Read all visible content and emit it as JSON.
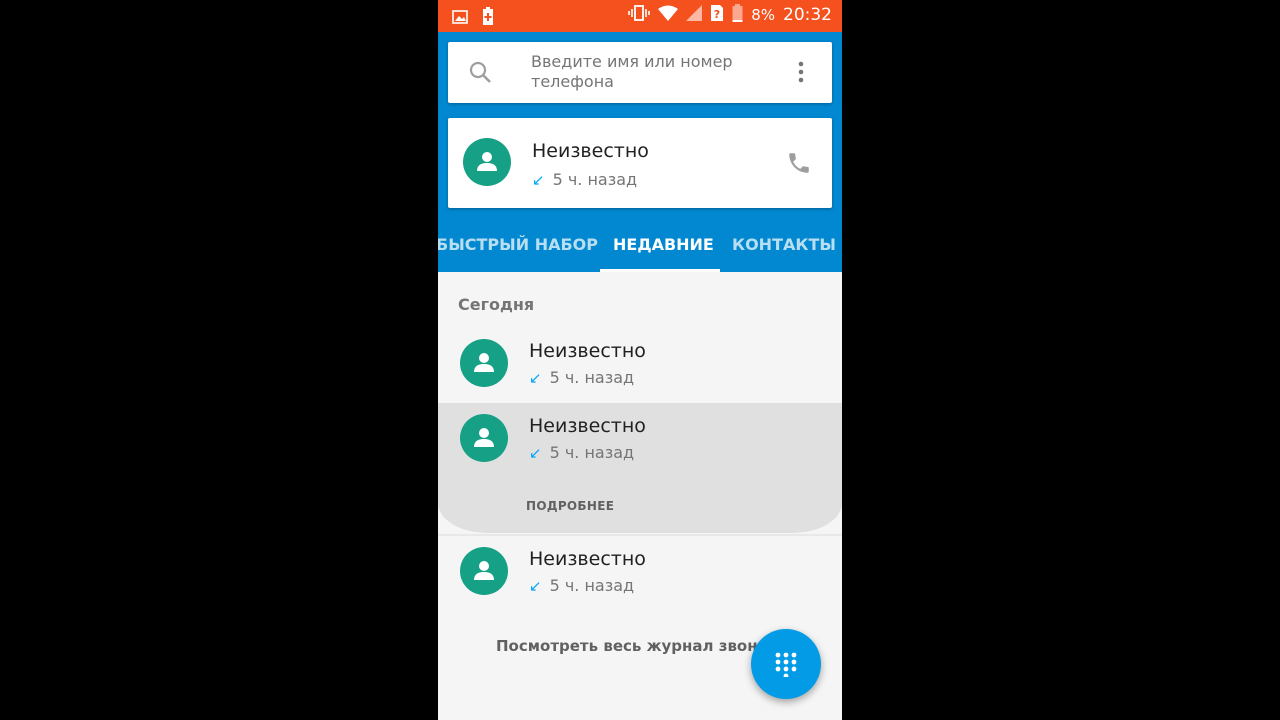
{
  "status_bar": {
    "battery_percent": "8%",
    "time": "20:32",
    "icons": [
      "image-icon",
      "battery-saver-icon",
      "vibrate-icon",
      "wifi-icon",
      "signal-icon",
      "no-sim-icon",
      "battery-icon"
    ]
  },
  "search": {
    "placeholder": "Введите имя или номер телефона"
  },
  "recent_card": {
    "name": "Неизвестно",
    "time": "5 ч. назад"
  },
  "tabs": [
    {
      "label": "БЫСТРЫЙ НАБОР"
    },
    {
      "label": "НЕДАВНИЕ",
      "active": true
    },
    {
      "label": "КОНТАКТЫ"
    }
  ],
  "calls": {
    "section_title": "Сегодня",
    "items": [
      {
        "name": "Неизвестно",
        "time": "5 ч. назад"
      },
      {
        "name": "Неизвестно",
        "time": "5 ч. назад",
        "expanded": true
      },
      {
        "name": "Неизвестно",
        "time": "5 ч. назад"
      }
    ],
    "details_label": "ПОДРОБНЕЕ",
    "view_all_label": "Посмотреть весь журнал звон"
  },
  "colors": {
    "status_bar": "#f4511e",
    "header": "#0288d1",
    "avatar": "#16a085",
    "fab": "#039be5"
  }
}
